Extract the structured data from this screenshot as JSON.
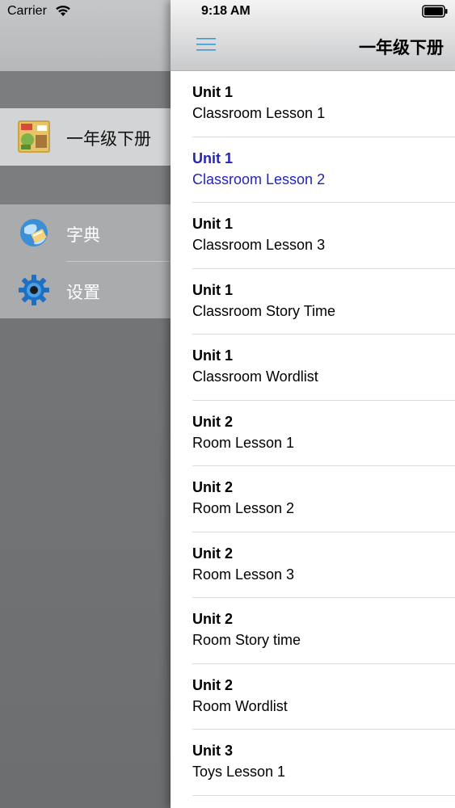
{
  "status_bar": {
    "carrier": "Carrier",
    "time": "9:18 AM"
  },
  "drawer": {
    "items": [
      {
        "label": "一年级下册",
        "icon": "book-cover-icon",
        "selected": true
      },
      {
        "label": "字典",
        "icon": "dictionary-globe-icon",
        "selected": false
      },
      {
        "label": "设置",
        "icon": "gear-icon",
        "selected": false
      }
    ]
  },
  "navbar": {
    "title": "一年级下册",
    "menu_icon": "hamburger-menu-icon"
  },
  "lessons": [
    {
      "unit": "Unit 1",
      "title": "Classroom Lesson 1",
      "active": false
    },
    {
      "unit": "Unit 1",
      "title": "Classroom Lesson 2",
      "active": true
    },
    {
      "unit": "Unit 1",
      "title": "Classroom Lesson 3",
      "active": false
    },
    {
      "unit": "Unit 1",
      "title": "Classroom Story Time",
      "active": false
    },
    {
      "unit": "Unit 1",
      "title": "Classroom Wordlist",
      "active": false
    },
    {
      "unit": "Unit 2",
      "title": "Room Lesson 1",
      "active": false
    },
    {
      "unit": "Unit 2",
      "title": "Room Lesson 2",
      "active": false
    },
    {
      "unit": "Unit 2",
      "title": "Room Lesson 3",
      "active": false
    },
    {
      "unit": "Unit 2",
      "title": "Room Story time",
      "active": false
    },
    {
      "unit": "Unit 2",
      "title": "Room Wordlist",
      "active": false
    },
    {
      "unit": "Unit 3",
      "title": "Toys Lesson 1",
      "active": false
    }
  ],
  "colors": {
    "active_text": "#2424b8",
    "menu_icon": "#3b9ad9"
  }
}
